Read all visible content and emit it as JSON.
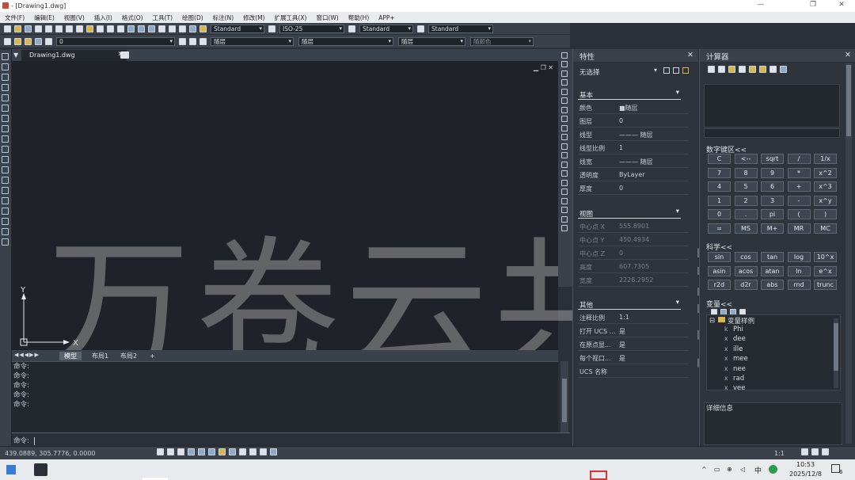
{
  "title_bar": {
    "title": "- [Drawing1.dwg]",
    "minimize": "—",
    "restore": "❐",
    "close": "✕"
  },
  "menu": [
    "文件(F)",
    "编辑(E)",
    "视图(V)",
    "插入(I)",
    "格式(O)",
    "工具(T)",
    "绘图(D)",
    "标注(N)",
    "修改(M)",
    "扩展工具(X)",
    "窗口(W)",
    "帮助(H)",
    "APP+"
  ],
  "toolbar": {
    "text_style": "Standard",
    "dim_style": "ISO-25",
    "table_style": "Standard",
    "mleader_style": "Standard",
    "layer": "0",
    "color": "随层",
    "linetype": "随层",
    "lineweight": "随层",
    "plotstyle": "随颜色"
  },
  "doc_tab": {
    "name": "Drawing1.dwg",
    "close": "✕"
  },
  "viewport_controls": "▁ ❐ ✕",
  "layout_tabs": {
    "model": "模型",
    "layout1": "布局1",
    "layout2": "布局2",
    "add": "+"
  },
  "command": {
    "history": [
      "命令:",
      "命令:",
      "命令:",
      "命令:",
      "命令:"
    ],
    "prompt": "命令:"
  },
  "status": {
    "coords": "439.0889, 305.7776, 0.0000",
    "annotation_scale": "1:1"
  },
  "properties": {
    "title": "特性",
    "selection": "无选择",
    "groups": {
      "basic": "基本",
      "view": "视图",
      "misc": "其他"
    },
    "basic": [
      {
        "k": "颜色",
        "v": "■随层"
      },
      {
        "k": "图层",
        "v": "0"
      },
      {
        "k": "线型",
        "v": "——— 随层"
      },
      {
        "k": "线型比例",
        "v": "1"
      },
      {
        "k": "线宽",
        "v": "——— 随层"
      },
      {
        "k": "透明度",
        "v": "ByLayer"
      },
      {
        "k": "厚度",
        "v": "0"
      }
    ],
    "view": [
      {
        "k": "中心点 X",
        "v": "555.8901"
      },
      {
        "k": "中心点 Y",
        "v": "450.4934"
      },
      {
        "k": "中心点 Z",
        "v": "0"
      },
      {
        "k": "高度",
        "v": "607.7305"
      },
      {
        "k": "宽度",
        "v": "2228.2952"
      }
    ],
    "misc": [
      {
        "k": "注释比例",
        "v": "1:1"
      },
      {
        "k": "打开 UCS ...",
        "v": "是"
      },
      {
        "k": "在原点显...",
        "v": "是"
      },
      {
        "k": "每个视口...",
        "v": "是"
      },
      {
        "k": "UCS 名称",
        "v": ""
      }
    ]
  },
  "calculator": {
    "title": "计算器",
    "numpad_label": "数字键区<<",
    "numpad": [
      [
        "C",
        "<--",
        "sqrt",
        "/",
        "1/x"
      ],
      [
        "7",
        "8",
        "9",
        "*",
        "x^2"
      ],
      [
        "4",
        "5",
        "6",
        "+",
        "x^3"
      ],
      [
        "1",
        "2",
        "3",
        "-",
        "x^y"
      ],
      [
        "0",
        ".",
        "pi",
        "(",
        ")"
      ],
      [
        "=",
        "MS",
        "M+",
        "MR",
        "MC"
      ]
    ],
    "sci_label": "科学<<",
    "sci": [
      [
        "sin",
        "cos",
        "tan",
        "log",
        "10^x"
      ],
      [
        "asin",
        "acos",
        "atan",
        "ln",
        "e^x"
      ],
      [
        "r2d",
        "d2r",
        "abs",
        "rnd",
        "trunc"
      ]
    ],
    "vars_label": "变量<<",
    "var_root": "变量样例",
    "vars": [
      {
        "type": "k",
        "name": "Phi"
      },
      {
        "type": "x",
        "name": "dee"
      },
      {
        "type": "x",
        "name": "ille"
      },
      {
        "type": "x",
        "name": "mee"
      },
      {
        "type": "x",
        "name": "nee"
      },
      {
        "type": "x",
        "name": "rad"
      },
      {
        "type": "x",
        "name": "vee"
      }
    ],
    "details_label": "详细信息"
  },
  "taskbar": {
    "time": "10:53",
    "date": "2025/12/8",
    "ime": "中",
    "notify": "6"
  },
  "watermark": "万卷云共享"
}
